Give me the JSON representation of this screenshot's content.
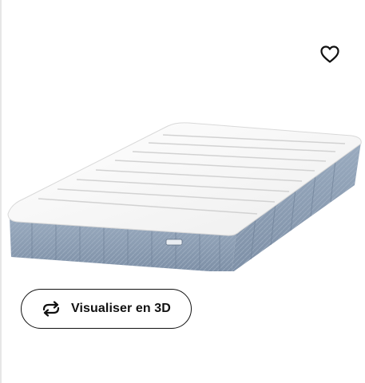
{
  "product": {
    "view_3d_label": "Visualiser en 3D"
  },
  "icons": {
    "favourite": "heart-outline-icon",
    "view_3d": "rotate-arrows-icon"
  },
  "colors": {
    "text": "#111111",
    "mattress_top": "#f7f7f7",
    "mattress_side": "#8b9db3"
  }
}
